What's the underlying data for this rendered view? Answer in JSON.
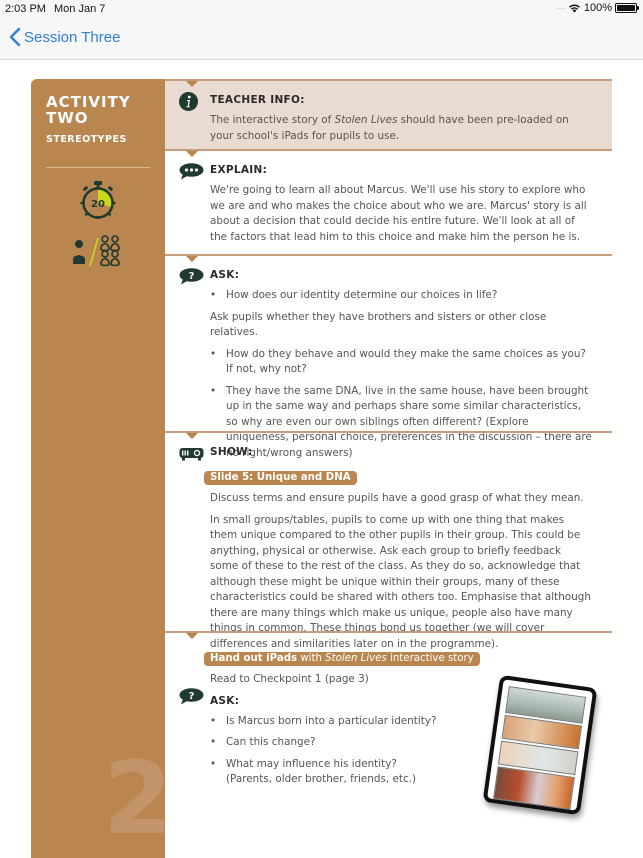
{
  "status_bar": {
    "time": "2:03 PM",
    "date": "Mon Jan 7",
    "battery_percent": "100%",
    "battery_level": 1.0
  },
  "nav": {
    "back_label": "Session Three"
  },
  "sidebar": {
    "activity_line1": "ACTIVITY",
    "activity_line2": "TWO",
    "subtitle": "STEREOTYPES",
    "timer_minutes": "20",
    "activity_number": "2",
    "colors": {
      "panel": "#b98650",
      "timer_highlight": "#c9d81b",
      "icon_dark": "#1f3a2e"
    }
  },
  "sections": {
    "teacher_info": {
      "heading": "TEACHER INFO:",
      "text_pre": "The interactive story of ",
      "text_italic": "Stolen Lives",
      "text_post": " should have been pre-loaded on your school's iPads for pupils to use."
    },
    "explain": {
      "heading": "EXPLAIN:",
      "text": "We're going to learn all about Marcus. We'll use his story to explore who we are and who makes the choice about who we are. Marcus' story is all about a decision that could decide his entire future. We'll look at all of the factors that lead him to this choice and make him the person he is."
    },
    "ask1": {
      "heading": "ASK:",
      "bullet1": "How does our identity determine our choices in life?",
      "para": "Ask pupils whether they have brothers and sisters or other close relatives.",
      "bullet2_line1": "How do they behave and would they make the same choices as you?",
      "bullet2_line2": "If not, why not?",
      "bullet3": "They have the same DNA, live in the same house, have been brought up in the same way and perhaps share some similar characteristics, so why are even our own siblings often different? (Explore uniqueness, personal choice, preferences in the discussion – there are no right/wrong answers)"
    },
    "show": {
      "heading": "SHOW:",
      "slide_pill": "Slide 5: Unique and DNA",
      "para1": "Discuss terms and ensure pupils have a good grasp of what they mean.",
      "para2": "In small groups/tables, pupils to come up with one thing that makes them unique compared to the other pupils in their group. This could be anything, physical or otherwise. Ask each group to briefly feedback some of these to the rest of the class. As they do so, acknowledge that although these might be unique within their groups, many of these characteristics could be shared with others too. Emphasise that although there are many things which make us unique, people also have many things in common. These things bond us together (we will cover differences and similarities later on in the programme)."
    },
    "handout": {
      "pill_bold": "Hand out iPads",
      "pill_mid": " with ",
      "pill_italic": "Stolen Lives",
      "pill_end": " interactive story",
      "read_to": "Read to Checkpoint 1 (page 3)",
      "ask_heading": "ASK:",
      "bullet1": "Is Marcus born into a particular identity?",
      "bullet2": "Can this change?",
      "bullet3_line1": "What may influence his identity?",
      "bullet3_line2": "(Parents, older brother, friends, etc.)"
    }
  },
  "bullet_char": "•"
}
